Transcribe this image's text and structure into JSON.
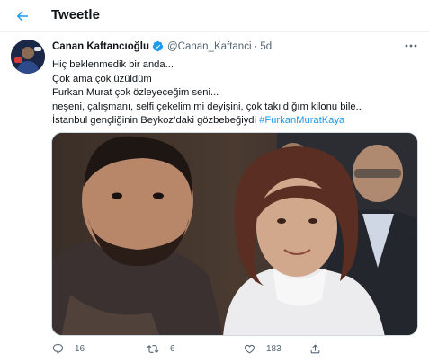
{
  "header": {
    "title": "Tweetle"
  },
  "tweet": {
    "display_name": "Canan Kaftancıoğlu",
    "handle": "@Canan_Kaftanci",
    "separator": "·",
    "time": "5d",
    "lines": [
      "Hiç beklenmedik bir anda...",
      "Çok ama çok üzüldüm",
      "Furkan Murat çok özleyeceğim seni...",
      "neşeni, çalışmanı, selfi çekelim mi deyişini, çok takıldığım kilonu bile..",
      "İstanbul gençliğinin Beykoz’daki gözbebeğiydi"
    ],
    "hashtag": "#FurkanMuratKaya",
    "actions": {
      "replies": "16",
      "retweets": "6",
      "likes": "183"
    }
  },
  "colors": {
    "accent": "#1d9bf0",
    "secondary_text": "#536471",
    "verified": "#1d9bf0"
  },
  "icons": [
    "back-arrow-icon",
    "verified-badge-icon",
    "more-icon",
    "reply-icon",
    "retweet-icon",
    "like-icon",
    "share-icon"
  ]
}
